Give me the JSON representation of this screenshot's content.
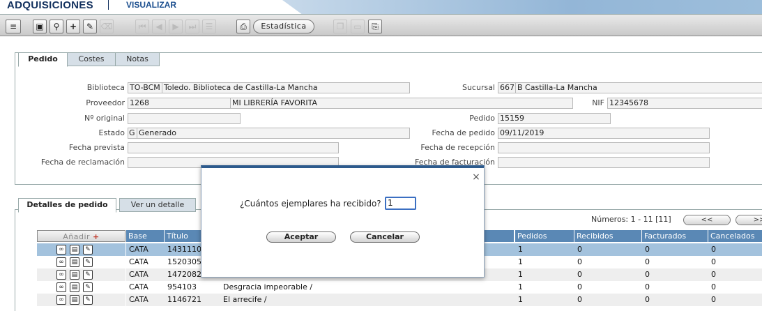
{
  "header": {
    "title": "ADQUISICIONES",
    "subtitle": "VISUALIZAR"
  },
  "toolbar": {
    "buttons": [
      {
        "icon": "menu-icon",
        "glyph": "≡"
      },
      {
        "icon": "disk-icon",
        "glyph": "▣"
      },
      {
        "icon": "search-icon",
        "glyph": "⚲"
      },
      {
        "icon": "plus-icon",
        "glyph": "+"
      },
      {
        "icon": "edit-icon",
        "glyph": "✎"
      },
      {
        "icon": "trash-icon",
        "glyph": "⌫"
      },
      {
        "icon": "first-icon",
        "glyph": "⏮"
      },
      {
        "icon": "prev-icon",
        "glyph": "◀"
      },
      {
        "icon": "next-icon",
        "glyph": "▶"
      },
      {
        "icon": "last-icon",
        "glyph": "⏭"
      },
      {
        "icon": "list-icon",
        "glyph": "☰"
      },
      {
        "icon": "print-icon",
        "glyph": "⎙"
      },
      {
        "icon": "copy-icon",
        "glyph": "❐"
      },
      {
        "icon": "folder-icon",
        "glyph": "▭"
      },
      {
        "icon": "export-icon",
        "glyph": "⎘"
      }
    ],
    "estadistica": "Estadística"
  },
  "tabs": [
    "Pedido",
    "Costes",
    "Notas"
  ],
  "form": {
    "biblioteca_label": "Biblioteca",
    "biblioteca_code": "TO-BCM",
    "biblioteca_name": "Toledo. Biblioteca de Castilla-La Mancha",
    "sucursal_label": "Sucursal",
    "sucursal_code": "667",
    "sucursal_name": "B Castilla-La Mancha",
    "proveedor_label": "Proveedor",
    "proveedor_code": "1268",
    "proveedor_name": "MI LIBRERÍA FAVORITA",
    "nif_label": "NIF",
    "nif_value": "12345678",
    "norig_label": "Nº original",
    "norig_value": "",
    "pedido_label": "Pedido",
    "pedido_value": "15159",
    "estado_label": "Estado",
    "estado_code": "G",
    "estado_name": "Generado",
    "fpedido_label": "Fecha de pedido",
    "fpedido_value": "09/11/2019",
    "fprevista_label": "Fecha prevista",
    "fprevista_value": "",
    "frecepcion_label": "Fecha de recepción",
    "frecepcion_value": "",
    "freclamacion_label": "Fecha de reclamación",
    "freclamacion_value": "",
    "ffacturacion_label": "Fecha de facturación",
    "ffacturacion_value": ""
  },
  "detail_tabs": [
    "Detalles de pedido",
    "Ver un detalle"
  ],
  "numeros": "Números: 1 - 11 [11]",
  "nav": {
    "prev": "<<",
    "next": ">>"
  },
  "grid": {
    "add_label": "Añadir",
    "headers": [
      "Base",
      "Título",
      "Pedidos",
      "Recibidos",
      "Facturados",
      "Cancelados"
    ],
    "rows": [
      {
        "base": "CATA",
        "num": "1431110",
        "titulo": "",
        "pedidos": "1",
        "recibidos": "0",
        "facturados": "0",
        "cancelados": "0"
      },
      {
        "base": "CATA",
        "num": "1520305",
        "titulo": "",
        "pedidos": "1",
        "recibidos": "0",
        "facturados": "0",
        "cancelados": "0"
      },
      {
        "base": "CATA",
        "num": "1472082",
        "titulo": "",
        "pedidos": "1",
        "recibidos": "0",
        "facturados": "0",
        "cancelados": "0"
      },
      {
        "base": "CATA",
        "num": "954103",
        "titulo": "Desgracia impeorable /",
        "pedidos": "1",
        "recibidos": "0",
        "facturados": "0",
        "cancelados": "0"
      },
      {
        "base": "CATA",
        "num": "1146721",
        "titulo": "El arrecife /",
        "pedidos": "1",
        "recibidos": "0",
        "facturados": "0",
        "cancelados": "0"
      }
    ]
  },
  "dialog": {
    "question": "¿Cuántos ejemplares ha recibido?",
    "value": "1",
    "accept": "Aceptar",
    "cancel": "Cancelar",
    "close_glyph": "×"
  }
}
